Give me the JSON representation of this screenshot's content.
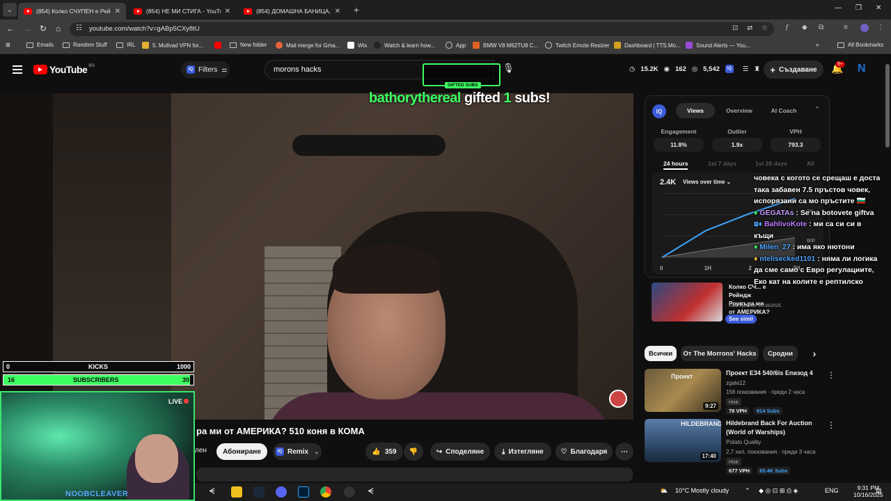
{
  "browser": {
    "tabs": [
      {
        "title": "(854) Колко СЧУПЕН е Рейндж",
        "active": true
      },
      {
        "title": "(854) НЕ МИ СТИГА - YouTube",
        "active": false
      },
      {
        "title": "(854) ДОМАШНА БАНИЦА,НО",
        "active": false
      }
    ],
    "url": "youtube.com/watch?v=gABp5CXy8tU",
    "bookmarks": [
      "Emails",
      "Random Stuff",
      "IRL",
      "5. Mullvad VPN for...",
      "New folder",
      "Mail merge for Gma...",
      "Wix",
      "Watch & learn how...",
      "App",
      "BMW V8 M62TU8 C...",
      "Twitch Emote Resizer",
      "Dashboard | TTS.Mo...",
      "Sound Alerts — You..."
    ],
    "all_bookmarks": "All Bookmarks"
  },
  "yt": {
    "logo": "YouTube",
    "region": "BG",
    "filters": "Filters",
    "search_query": "morons hacks",
    "stats": {
      "views": "15.2K",
      "likes": "162",
      "comments": "5,542"
    },
    "create": "Създаване",
    "notif_badge": "9+"
  },
  "overlay": {
    "gifted_user": "bathorythereal",
    "gifted_word": "gifted",
    "gifted_count": "1",
    "gifted_suffix": "subs!",
    "gift_box_label": "GIFTED SUBS",
    "kicks": {
      "left": "0",
      "label": "KICKS",
      "right": "1000",
      "progress": 0
    },
    "subscribers": {
      "left": "16",
      "label": "SUBSCRIBERS",
      "right": "30",
      "progress": 0.98
    },
    "live": "LIVE",
    "streamer_tag": "NOOBCLEAVER"
  },
  "video": {
    "title": "ра ми от АМЕРИКА? 510 коня в КОМА",
    "left_fragment": "лен",
    "subscribe": "Абониране",
    "remix": "Remix",
    "likes": "359",
    "share": "Споделяне",
    "download": "Изтегляне",
    "thanks": "Благодаря"
  },
  "iq": {
    "tabs": [
      "Views",
      "Overview",
      "AI Coach"
    ],
    "metric_labels": [
      "Engagement",
      "Outlier",
      "VPH"
    ],
    "metric_values": [
      "11.8%",
      "1.9x",
      "793.3"
    ],
    "ranges": [
      "24 hours",
      "1st 7 days",
      "1st 28 days",
      "All"
    ],
    "total": "2.4K",
    "mode": "Views over time",
    "y_ticks": [
      "2K",
      "600"
    ],
    "x_ticks": [
      "0",
      "1H",
      "2",
      "3H"
    ],
    "see_similar": "See simil"
  },
  "chart_data": {
    "type": "line",
    "x": [
      "0",
      "1H",
      "2",
      "3H"
    ],
    "series": [
      {
        "values": [
          0,
          1100,
          1800,
          2400
        ]
      },
      {
        "values": [
          0,
          300,
          550,
          800
        ]
      }
    ],
    "ylim": [
      0,
      2600
    ]
  },
  "suggested": {
    "card_title": "Колко СЧ... е Рейндж Роувъра ми от АМЕРИКА?",
    "last_updated": "Last Updated: 10/16/2025"
  },
  "chips": [
    "Всички",
    "От The Morrons' Hacks",
    "Сродни"
  ],
  "videos": [
    {
      "title": "Проект Е34 540/6is Епизод 4",
      "channel": "zgala12",
      "meta": "156 показвания · преди 2 часа",
      "badge": "Нов",
      "vph": "78 VPH",
      "subs": "914 Subs",
      "duration": "9:27",
      "thumb_text": "Проект"
    },
    {
      "title": "Hildebrand Back For Auction (World of Warships)",
      "channel": "Potato Quality",
      "meta": "2,7 хил. показвания · преди 3 часа",
      "badge": "Нов",
      "vph": "677 VPH",
      "subs": "65.4K Subs",
      "duration": "17:40",
      "thumb_text": "HILDEBRAND"
    }
  ],
  "chat": [
    {
      "user": "",
      "text": "човека с когото се срещаш е доста така забавен 7.5 пръстов човек, испорязани са мо пръстите 🇧🇬"
    },
    {
      "user": "GEGATAs",
      "text": ": Se na botovete giftva"
    },
    {
      "user": "BahlivoKote",
      "text": ": ми са си си в къщи"
    },
    {
      "user": "Milen_27",
      "text": ": има яко нютони"
    },
    {
      "user": "ntelisecked1101",
      "text": ": няма ли логика да сме само с Евро регулациите, Еко кат на колите е рептилско"
    }
  ],
  "taskbar": {
    "weather": "10°C  Mostly cloudy",
    "lang": "ENG",
    "time": "9:31 PM",
    "date": "10/16/2025"
  }
}
